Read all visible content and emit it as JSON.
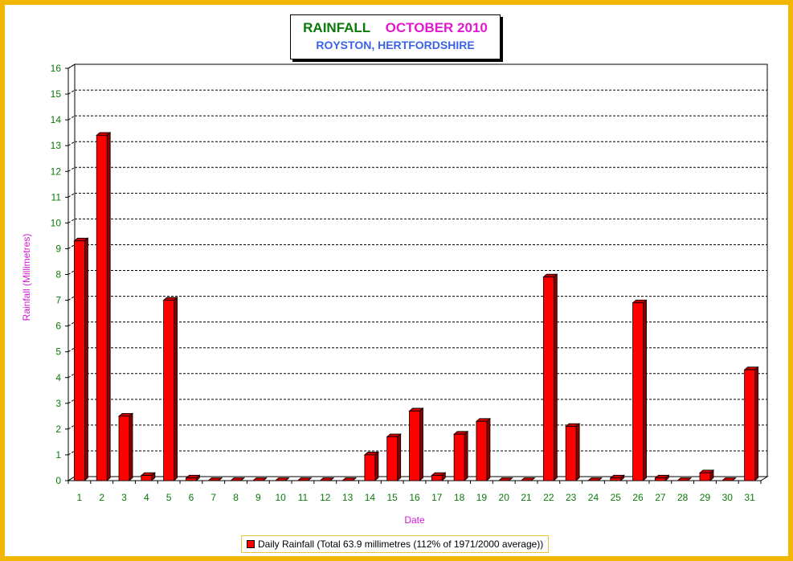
{
  "chart_data": {
    "type": "bar",
    "title": "RAINFALL",
    "title_period": "OCTOBER 2010",
    "subtitle": "ROYSTON, HERTFORDSHIRE",
    "xlabel": "Date",
    "ylabel": "Rainfall  (Millimetres)",
    "ylim": [
      0,
      16
    ],
    "yticks": [
      "0",
      "1",
      "2",
      "3",
      "4",
      "5",
      "6",
      "7",
      "8",
      "9",
      "10",
      "11",
      "12",
      "13",
      "14",
      "15",
      "16"
    ],
    "grid": true,
    "legend_position": "bottom",
    "categories": [
      "1",
      "2",
      "3",
      "4",
      "5",
      "6",
      "7",
      "8",
      "9",
      "10",
      "11",
      "12",
      "13",
      "14",
      "15",
      "16",
      "17",
      "18",
      "19",
      "20",
      "21",
      "22",
      "23",
      "24",
      "25",
      "26",
      "27",
      "28",
      "29",
      "30",
      "31"
    ],
    "series": [
      {
        "name": "Daily Rainfall (Total 63.9 millimetres (112% of 1971/2000 average))",
        "color": "#ff0000",
        "values": [
          9.3,
          13.4,
          2.5,
          0.2,
          7.0,
          0.1,
          0,
          0,
          0,
          0,
          0,
          0,
          0,
          1.0,
          1.7,
          2.7,
          0.2,
          1.8,
          2.3,
          0,
          0,
          7.9,
          2.1,
          0,
          0.1,
          6.9,
          0.1,
          0,
          0.3,
          0,
          4.3
        ]
      }
    ]
  }
}
